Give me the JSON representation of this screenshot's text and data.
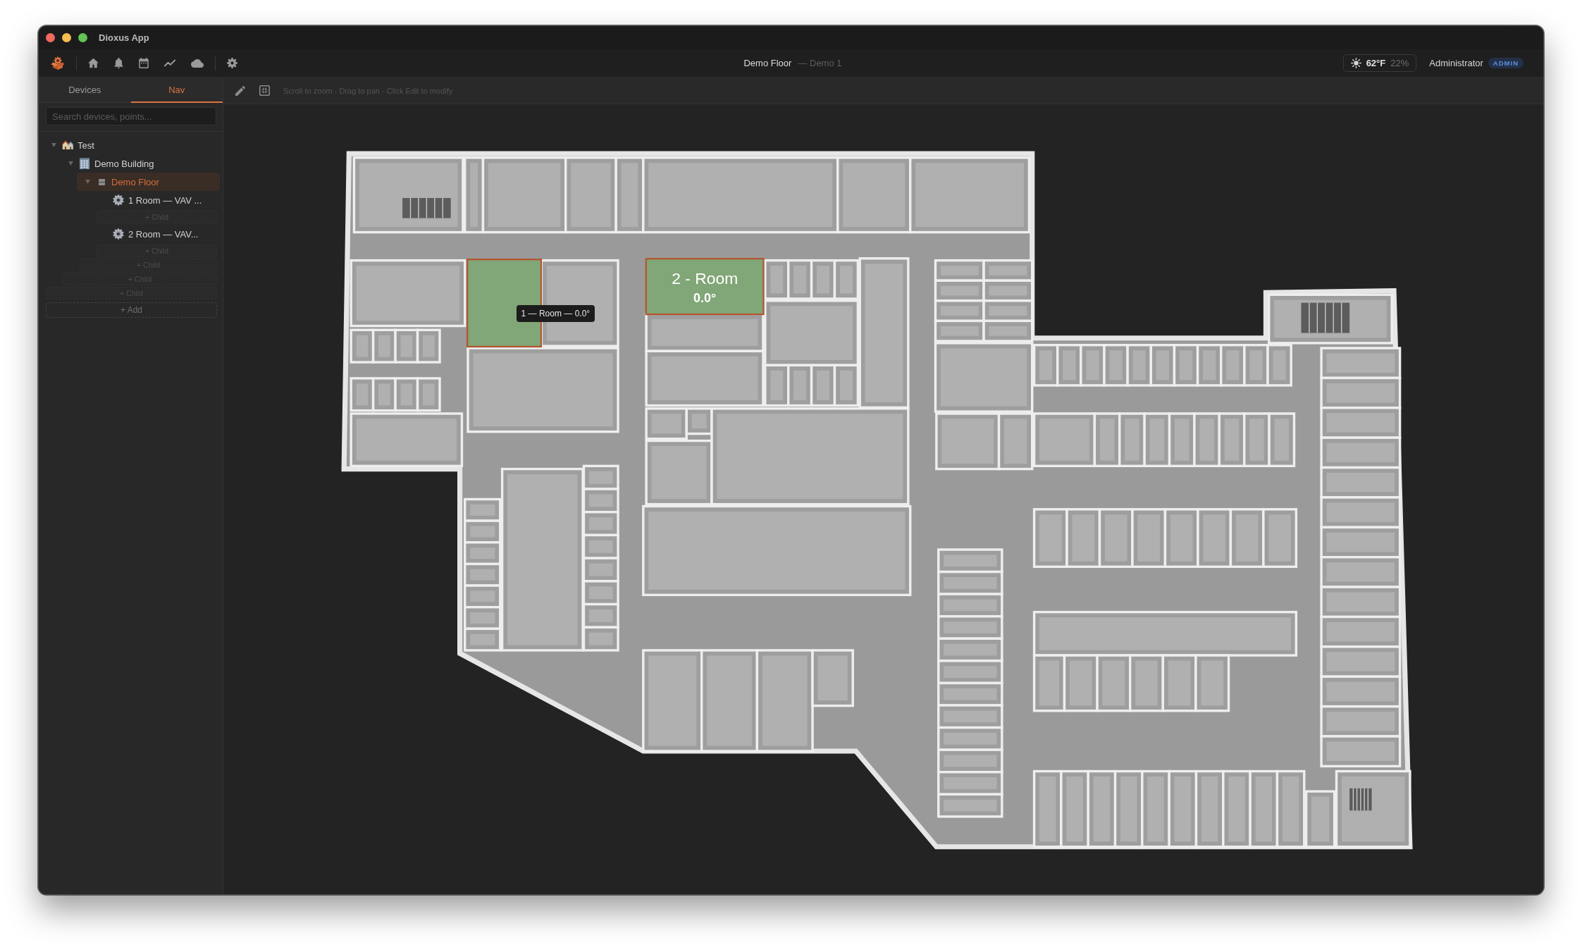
{
  "window": {
    "title": "Dioxus App"
  },
  "top_bar": {
    "title": "Demo Floor",
    "subtitle": "— Demo 1",
    "weather": {
      "temperature": "62°F",
      "humidity": "22%"
    },
    "user": {
      "name": "Administrator",
      "role": "ADMIN"
    }
  },
  "sidebar": {
    "tabs": [
      {
        "label": "Devices",
        "selected": false
      },
      {
        "label": "Nav",
        "selected": true
      }
    ],
    "search": {
      "placeholder": "Search devices, points..."
    },
    "tree": {
      "items": [
        {
          "label": "Test",
          "kind": "site",
          "expanded": true,
          "selected": false,
          "add_label": "+ Child",
          "children": [
            {
              "label": "Demo Building",
              "kind": "building",
              "expanded": true,
              "selected": false,
              "add_label": "+ Child",
              "children": [
                {
                  "label": "Demo Floor",
                  "kind": "floor",
                  "expanded": true,
                  "selected": true,
                  "add_label": "+ Child",
                  "children": [
                    {
                      "label": "1 Room — VAV ...",
                      "kind": "equipment",
                      "selected": false,
                      "add_label": "+ Child"
                    },
                    {
                      "label": "2 Room — VAV...",
                      "kind": "equipment",
                      "selected": false,
                      "add_label": "+ Child"
                    }
                  ]
                }
              ]
            }
          ]
        }
      ],
      "add_label": "+ Add"
    }
  },
  "canvas": {
    "hint": "Scroll to zoom · Drag to pan · Click Edit to modify",
    "rooms": [
      {
        "tooltip": "1 — Room — 0.0°"
      },
      {
        "name": "2 - Room",
        "reading": "0.0°"
      }
    ]
  }
}
